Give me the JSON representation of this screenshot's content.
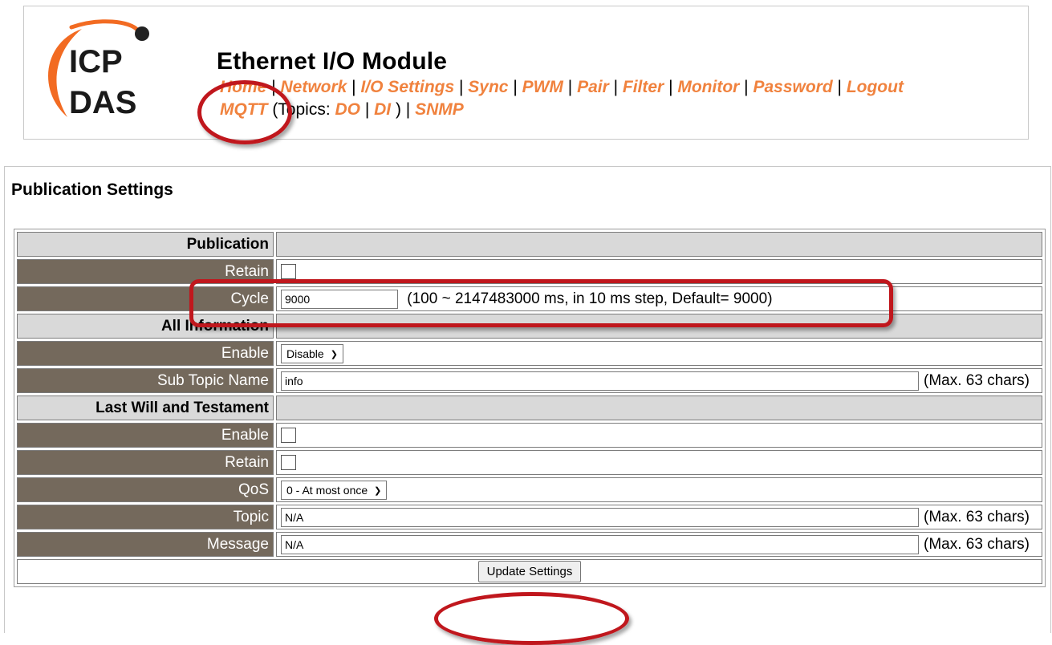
{
  "header": {
    "title": "Ethernet I/O Module",
    "logo_text": "ICP DAS",
    "nav_row1": [
      "Home",
      "Network",
      "I/O Settings",
      "Sync",
      "PWM",
      "Pair",
      "Filter",
      "Monitor",
      "Password",
      "Logout"
    ],
    "nav_row2": {
      "mqtt": "MQTT",
      "topics_open": " (Topics: ",
      "do": "DO",
      "di": "DI",
      "topics_close": " ) | ",
      "snmp": "SNMP"
    }
  },
  "panel": {
    "title": "Publication Settings",
    "publication": {
      "heading": "Publication",
      "retain_label": "Retain",
      "cycle_label": "Cycle",
      "cycle_value": "9000",
      "cycle_hint": "(100 ~ 2147483000 ms, in 10 ms step, Default= 9000)"
    },
    "all_info": {
      "heading": "All Information",
      "enable_label": "Enable",
      "enable_value": "Disable",
      "subtopic_label": "Sub Topic Name",
      "subtopic_value": "info",
      "subtopic_hint": "(Max. 63 chars)"
    },
    "lwt": {
      "heading": "Last Will and Testament",
      "enable_label": "Enable",
      "retain_label": "Retain",
      "qos_label": "QoS",
      "qos_value": "0 - At most once",
      "topic_label": "Topic",
      "topic_value": "N/A",
      "topic_hint": "(Max. 63 chars)",
      "message_label": "Message",
      "message_value": "N/A",
      "message_hint": "(Max. 63 chars)"
    },
    "update_button": "Update Settings"
  },
  "colors": {
    "link": "#f0823e",
    "label_bg": "#74695c",
    "section_bg": "#d9d9d9",
    "annotation": "#c0171d",
    "logo_orange": "#f26b22"
  }
}
